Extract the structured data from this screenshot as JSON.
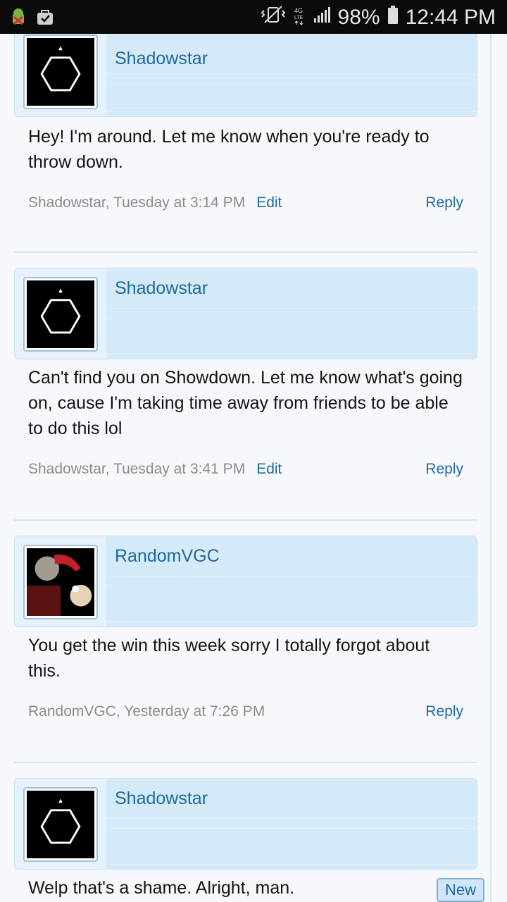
{
  "status_bar": {
    "battery": "98%",
    "time": "12:44 PM",
    "network": "4G LTE"
  },
  "posts": [
    {
      "username": "Shadowstar",
      "avatar": "hexagon-avatar",
      "message": "Hey! I'm around. Let me know when you're ready to throw down.",
      "meta": "Shadowstar, Tuesday at 3:14 PM",
      "edit": "Edit",
      "reply": "Reply"
    },
    {
      "username": "Shadowstar",
      "avatar": "hexagon-avatar",
      "message": "Can't find you on Showdown. Let me know what's going on, cause I'm taking time away from friends to be able to do this lol",
      "meta": "Shadowstar, Tuesday at 3:41 PM",
      "edit": "Edit",
      "reply": "Reply"
    },
    {
      "username": "RandomVGC",
      "avatar": "photo-avatar",
      "message": "You get the win this week sorry I totally forgot about this.",
      "meta": "RandomVGC, Yesterday at 7:26 PM",
      "reply": "Reply"
    },
    {
      "username": "Shadowstar",
      "avatar": "hexagon-avatar",
      "message": "Welp that's a shame. Alright, man."
    }
  ],
  "new_button": "New"
}
